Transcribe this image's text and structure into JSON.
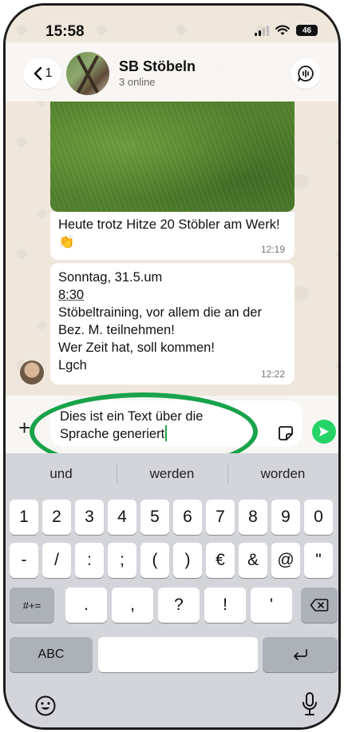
{
  "status_bar": {
    "time": "15:58",
    "battery": "46"
  },
  "header": {
    "back_count": "1",
    "title": "SB Stöbeln",
    "subtitle": "3 online"
  },
  "messages": [
    {
      "text": "Heute trotz Hitze 20 Stöbler am Werk!👏",
      "time": "12:19"
    },
    {
      "lines": [
        "Sonntag, 31.5.um",
        "8:30",
        "Stöbeltraining, vor allem die an der",
        "Bez. M. teilnehmen!",
        "Wer Zeit hat, soll kommen!",
        "Lgch"
      ],
      "time": "12:22"
    }
  ],
  "input": {
    "line1": "Dies ist ein Text über die",
    "line2": "Sprache generiert"
  },
  "keyboard": {
    "suggestions": [
      "und",
      "werden",
      "worden"
    ],
    "row1": [
      "1",
      "2",
      "3",
      "4",
      "5",
      "6",
      "7",
      "8",
      "9",
      "0"
    ],
    "row2": [
      "-",
      "/",
      ":",
      ";",
      "(",
      ")",
      "€",
      "&",
      "@",
      "\""
    ],
    "row3_toggle": "#+=",
    "row3": [
      ".",
      ",",
      "?",
      "!",
      "'"
    ],
    "abc": "ABC"
  },
  "colors": {
    "accent": "#25d366",
    "annotation": "#18a34a"
  }
}
